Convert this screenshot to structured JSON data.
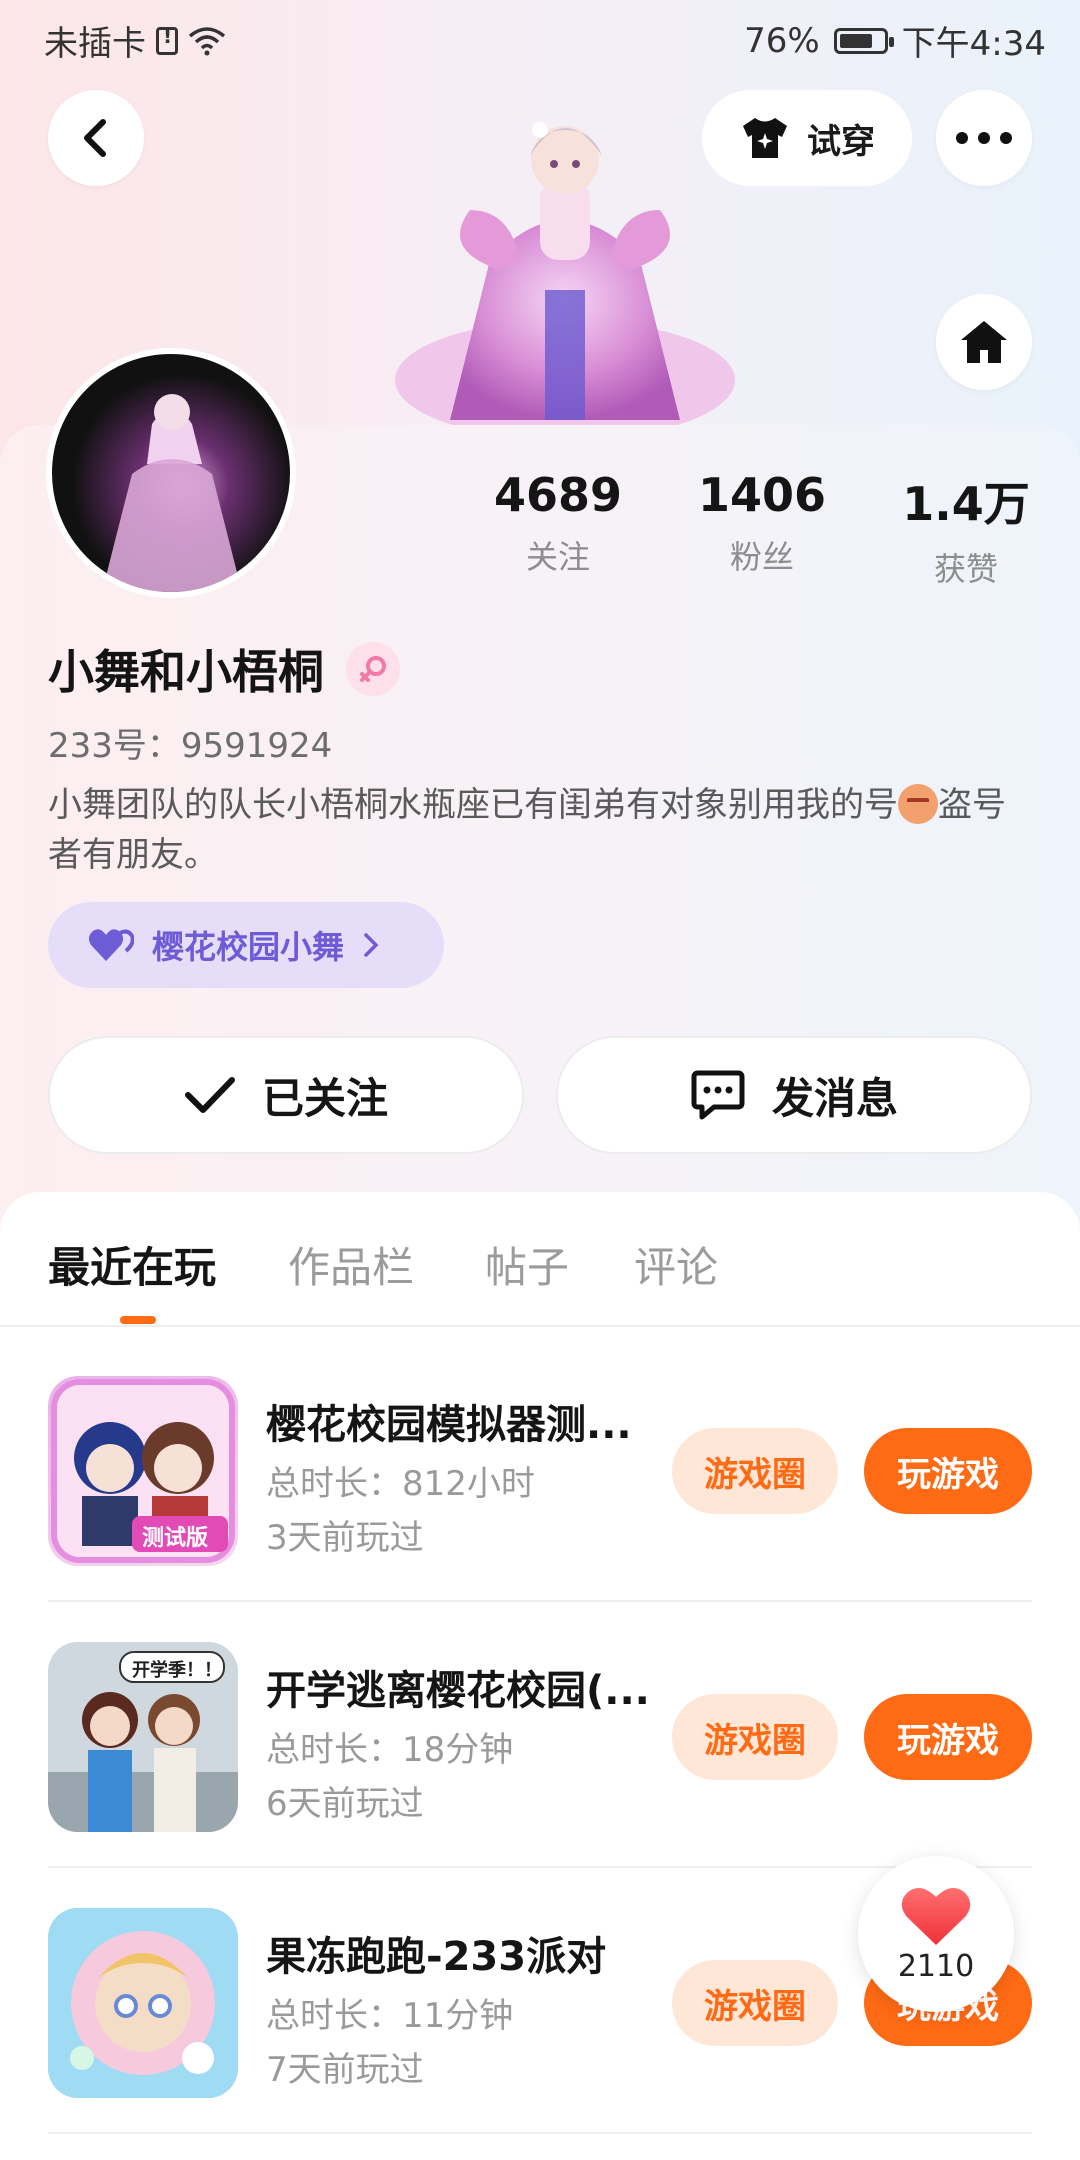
{
  "status_bar": {
    "carrier": "未插卡",
    "battery_percent": "76%",
    "battery_level": 0.76,
    "time": "下午4:34"
  },
  "header": {
    "try_on_label": "试穿",
    "icons": [
      "back-icon",
      "shirt-icon",
      "more-icon",
      "home-icon"
    ]
  },
  "profile": {
    "stats": [
      {
        "value": "4689",
        "label": "关注"
      },
      {
        "value": "1406",
        "label": "粉丝"
      },
      {
        "value": "1.4万",
        "label": "获赞"
      }
    ],
    "name": "小舞和小梧桐",
    "uid": "233号：9591924",
    "bio_before_emoji": "小舞团队的队长小梧桐水瓶座已有闺弟有对象别用我的号",
    "bio_after_emoji": "盗号者有朋友。",
    "guild_label": "樱花校园小舞",
    "follow_button": "已关注",
    "message_button": "发消息"
  },
  "tabs": [
    {
      "label": "最近在玩",
      "active": true
    },
    {
      "label": "作品栏",
      "active": false
    },
    {
      "label": "帖子",
      "active": false
    },
    {
      "label": "评论",
      "active": false
    }
  ],
  "games": [
    {
      "title": "樱花校园模拟器测...",
      "duration": "总时长：812小时",
      "last_played": "3天前玩过",
      "circle_button": "游戏圈",
      "play_button": "玩游戏",
      "badge": "测试版"
    },
    {
      "title": "开学逃离樱花校园(...",
      "duration": "总时长：18分钟",
      "last_played": "6天前玩过",
      "circle_button": "游戏圈",
      "play_button": "玩游戏",
      "badge": "开学季！！"
    },
    {
      "title": "果冻跑跑-233派对",
      "duration": "总时长：11分钟",
      "last_played": "7天前玩过",
      "circle_button": "游戏圈",
      "play_button": "玩游戏",
      "badge": ""
    }
  ],
  "like_float": {
    "count": "2110"
  },
  "colors": {
    "accent": "#ff6a14",
    "accent_light": "#ffe7d8",
    "guild_text": "#6e5bd6",
    "guild_bg": "#e6def8"
  }
}
